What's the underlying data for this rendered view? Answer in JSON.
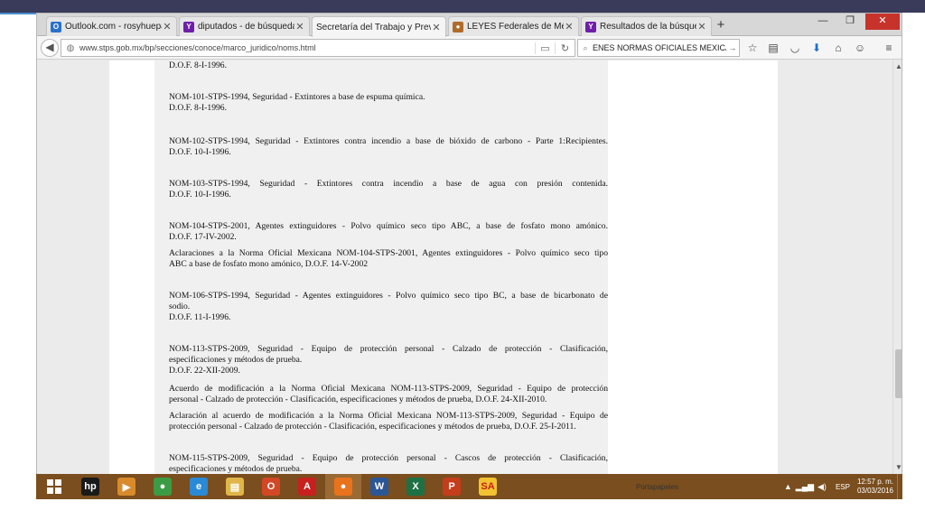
{
  "browser": {
    "tabs": [
      {
        "label": "Outlook.com - rosyhuepa...",
        "icon": "outlook-icon",
        "color": "#2a72c9",
        "glyph": "O",
        "active": false
      },
      {
        "label": "diputados - de búsqueda",
        "icon": "yahoo-icon",
        "color": "#6e1fa8",
        "glyph": "Y",
        "active": false
      },
      {
        "label": "Secretaría del Trabajo y Previsi...",
        "icon": "none",
        "color": "",
        "glyph": "",
        "active": true
      },
      {
        "label": "LEYES Federales de México",
        "icon": "mexico-seal-icon",
        "color": "#b06a2a",
        "glyph": "●",
        "active": false
      },
      {
        "label": "Resultados de la búsqued...",
        "icon": "yahoo-icon",
        "color": "#6e1fa8",
        "glyph": "Y",
        "active": false
      }
    ],
    "url": "www.stps.gob.mx/bp/secciones/conoce/marco_juridico/noms.html",
    "search_value": "ENES NORMAS OFICIALES MEXICANAS"
  },
  "document": {
    "paragraphs": [
      {
        "lines": [
          "D.O.F. 8-I-1996."
        ]
      },
      {
        "lines": [
          "NOM-101-STPS-1994, Seguridad - Extintores a base de espuma química.",
          "D.O.F. 8-I-1996."
        ]
      },
      {
        "lines": [
          "NOM-102-STPS-1994, Seguridad - Extintores contra incendio a base de bióxido de carbono - Parte 1:Recipientes.",
          "D.O.F. 10-I-1996."
        ]
      },
      {
        "lines": [
          "NOM-103-STPS-1994, Seguridad - Extintores contra incendio a base de agua con presión contenida.",
          "D.O.F. 10-I-1996."
        ]
      },
      {
        "lines": [
          "NOM-104-STPS-2001, Agentes extinguidores - Polvo químico seco tipo ABC, a base de fosfato mono amónico.",
          "D.O.F. 17-IV-2002."
        ]
      },
      {
        "lines": [
          "Aclaraciones a la Norma Oficial Mexicana NOM-104-STPS-2001, Agentes extinguidores - Polvo químico seco tipo",
          "ABC a base de fosfato mono amónico, D.O.F. 14-V-2002"
        ]
      },
      {
        "lines": [
          "NOM-106-STPS-1994, Seguridad - Agentes extinguidores - Polvo químico seco tipo BC, a base de bicarbonato de",
          "sodio.",
          "D.O.F. 11-I-1996."
        ]
      },
      {
        "lines": [
          "NOM-113-STPS-2009, Seguridad - Equipo de protección personal - Calzado de protección - Clasificación,",
          "especificaciones y métodos de prueba.",
          "D.O.F. 22-XII-2009."
        ]
      },
      {
        "lines": [
          "Acuerdo de modificación a la Norma Oficial Mexicana NOM-113-STPS-2009, Seguridad - Equipo de protección",
          "personal - Calzado de protección - Clasificación, especificaciones y métodos de prueba, D.O.F. 24-XII-2010."
        ]
      },
      {
        "lines": [
          "Aclaración al acuerdo de modificación a la Norma Oficial Mexicana NOM-113-STPS-2009, Seguridad - Equipo de",
          "protección personal - Calzado de protección - Clasificación, especificaciones y métodos de prueba, D.O.F. 25-I-2011."
        ]
      },
      {
        "lines": [
          "NOM-115-STPS-2009, Seguridad - Equipo de protección personal - Cascos de protección - Clasificación,",
          "especificaciones y métodos de prueba."
        ]
      }
    ]
  },
  "taskbar": {
    "apps": [
      {
        "icon": "hp-icon",
        "glyph": "hp",
        "color": "#1a1a1a"
      },
      {
        "icon": "media-player-icon",
        "glyph": "▶",
        "color": "#d98a2b"
      },
      {
        "icon": "chrome-icon",
        "glyph": "●",
        "color": "#3c9c45"
      },
      {
        "icon": "internet-explorer-icon",
        "glyph": "e",
        "color": "#2a8ad6"
      },
      {
        "icon": "file-explorer-icon",
        "glyph": "▤",
        "color": "#e0b64a"
      },
      {
        "icon": "office-icon",
        "glyph": "O",
        "color": "#d24726"
      },
      {
        "icon": "acrobat-icon",
        "glyph": "A",
        "color": "#c8201e"
      },
      {
        "icon": "firefox-icon",
        "glyph": "●",
        "color": "#e8731c"
      },
      {
        "icon": "word-icon",
        "glyph": "W",
        "color": "#2b5797"
      },
      {
        "icon": "excel-icon",
        "glyph": "X",
        "color": "#1e7145"
      },
      {
        "icon": "powerpoint-icon",
        "glyph": "P",
        "color": "#c43e1c"
      },
      {
        "icon": "sa-app-icon",
        "glyph": "SA",
        "color": "#f2c230"
      }
    ],
    "clipboard_label": "Portapapeles",
    "language": "ESP",
    "time": "12:57 p. m.",
    "date": "03/03/2016"
  }
}
